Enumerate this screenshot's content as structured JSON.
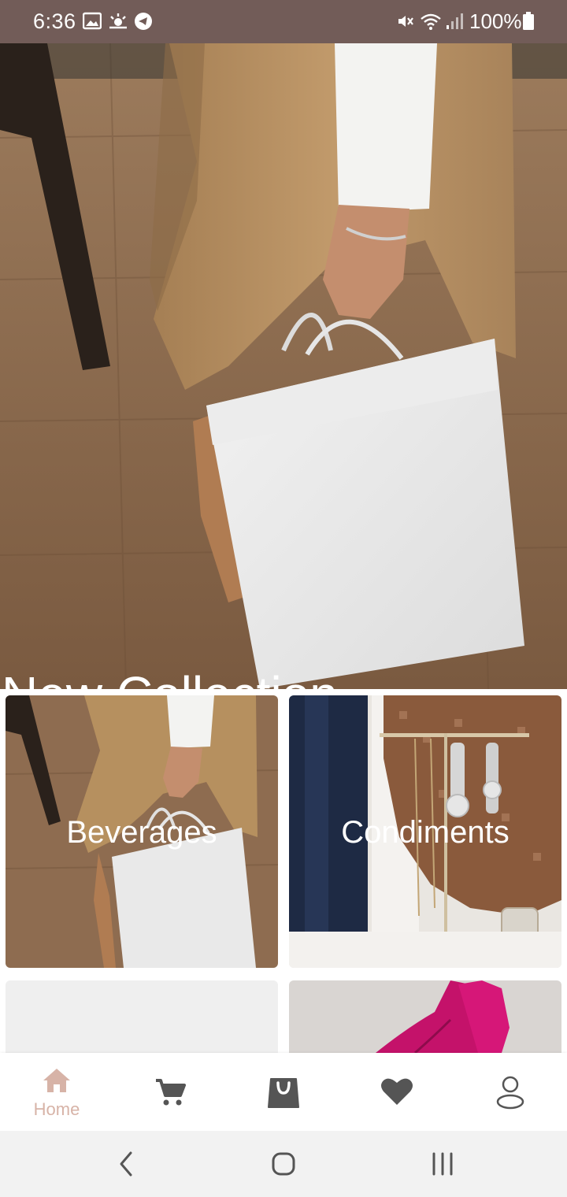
{
  "status_bar": {
    "time": "6:36",
    "battery": "100%",
    "icons": [
      "gallery-icon",
      "weather-icon",
      "telegram-icon",
      "mute-icon",
      "wifi-icon",
      "signal-icon",
      "battery-icon"
    ]
  },
  "hero": {
    "title": "New Collection"
  },
  "categories": [
    {
      "label": "Beverages"
    },
    {
      "label": "Condiments"
    },
    {
      "label": ""
    },
    {
      "label": ""
    }
  ],
  "bottom_nav": {
    "items": [
      {
        "label": "Home",
        "icon": "home-icon",
        "active": true
      },
      {
        "label": "",
        "icon": "cart-icon",
        "active": false
      },
      {
        "label": "",
        "icon": "shopping-bag-icon",
        "active": false
      },
      {
        "label": "",
        "icon": "heart-icon",
        "active": false
      },
      {
        "label": "",
        "icon": "profile-icon",
        "active": false
      }
    ],
    "active_color": "#d7b3a7",
    "inactive_color": "#555555"
  },
  "system_nav": {
    "icons": [
      "back-icon",
      "home-circle-icon",
      "recents-icon"
    ]
  },
  "colors": {
    "status_bar": "#725c58",
    "accent": "#d7b3a7"
  }
}
